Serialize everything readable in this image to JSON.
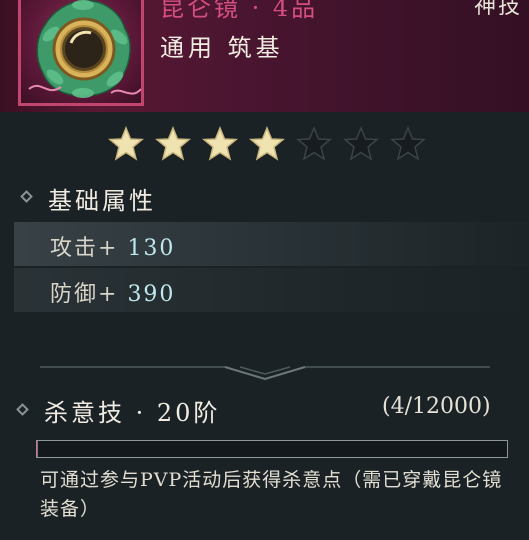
{
  "item": {
    "name": "昆仑镜 · 4品",
    "corner_text": "神技",
    "type_line": "通用 筑基",
    "icon": "kunlun-mirror-icon"
  },
  "stars": {
    "filled": 4,
    "total": 7,
    "filled_color": "#f0e3b2",
    "empty_color": "#161c20"
  },
  "base_attributes": {
    "title": "基础属性",
    "rows": [
      {
        "label": "攻击+",
        "value": "130"
      },
      {
        "label": "防御+",
        "value": "390"
      }
    ]
  },
  "skill": {
    "title": "杀意技 · 20阶",
    "progress_text": "(4/12000)",
    "progress_current": 4,
    "progress_max": 12000,
    "description": "可通过参与PVP活动后获得杀意点（需已穿戴昆仑镜装备）"
  },
  "colors": {
    "quality_accent": "#d44f80",
    "header_bg": "#4a1530",
    "panel_bg": "#1b2226"
  }
}
